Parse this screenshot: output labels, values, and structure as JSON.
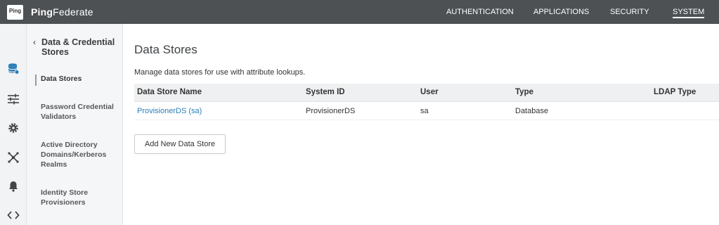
{
  "app": {
    "logo_text": "Ping",
    "brand_bold": "Ping",
    "brand_rest": "Federate"
  },
  "nav": [
    {
      "label": "AUTHENTICATION",
      "active": false
    },
    {
      "label": "APPLICATIONS",
      "active": false
    },
    {
      "label": "SECURITY",
      "active": false
    },
    {
      "label": "SYSTEM",
      "active": true
    }
  ],
  "iconrail": [
    {
      "icon": "database-icon"
    },
    {
      "icon": "sliders-icon"
    },
    {
      "icon": "gear-icon"
    },
    {
      "icon": "cluster-icon"
    },
    {
      "icon": "bell-icon"
    },
    {
      "icon": "code-icon"
    }
  ],
  "subnav": {
    "back_glyph": "‹",
    "heading": "Data & Credential Stores",
    "items": [
      {
        "label": "Data Stores",
        "active": true
      },
      {
        "label": "Password Credential Validators",
        "active": false
      },
      {
        "label": "Active Directory Domains/Kerberos Realms",
        "active": false
      },
      {
        "label": "Identity Store Provisioners",
        "active": false
      }
    ]
  },
  "main": {
    "title": "Data Stores",
    "description": "Manage data stores for use with attribute lookups.",
    "columns": [
      "Data Store Name",
      "System ID",
      "User",
      "Type",
      "LDAP Type"
    ],
    "rows": [
      {
        "name": "ProvisionerDS (sa)",
        "system_id": "ProvisionerDS",
        "user": "sa",
        "type": "Database",
        "ldap_type": ""
      }
    ],
    "add_button": "Add New Data Store"
  },
  "colors": {
    "topbar": "#4d5154",
    "link": "#2b7db8",
    "icon_active": "#2b7db8",
    "icon": "#444444"
  }
}
